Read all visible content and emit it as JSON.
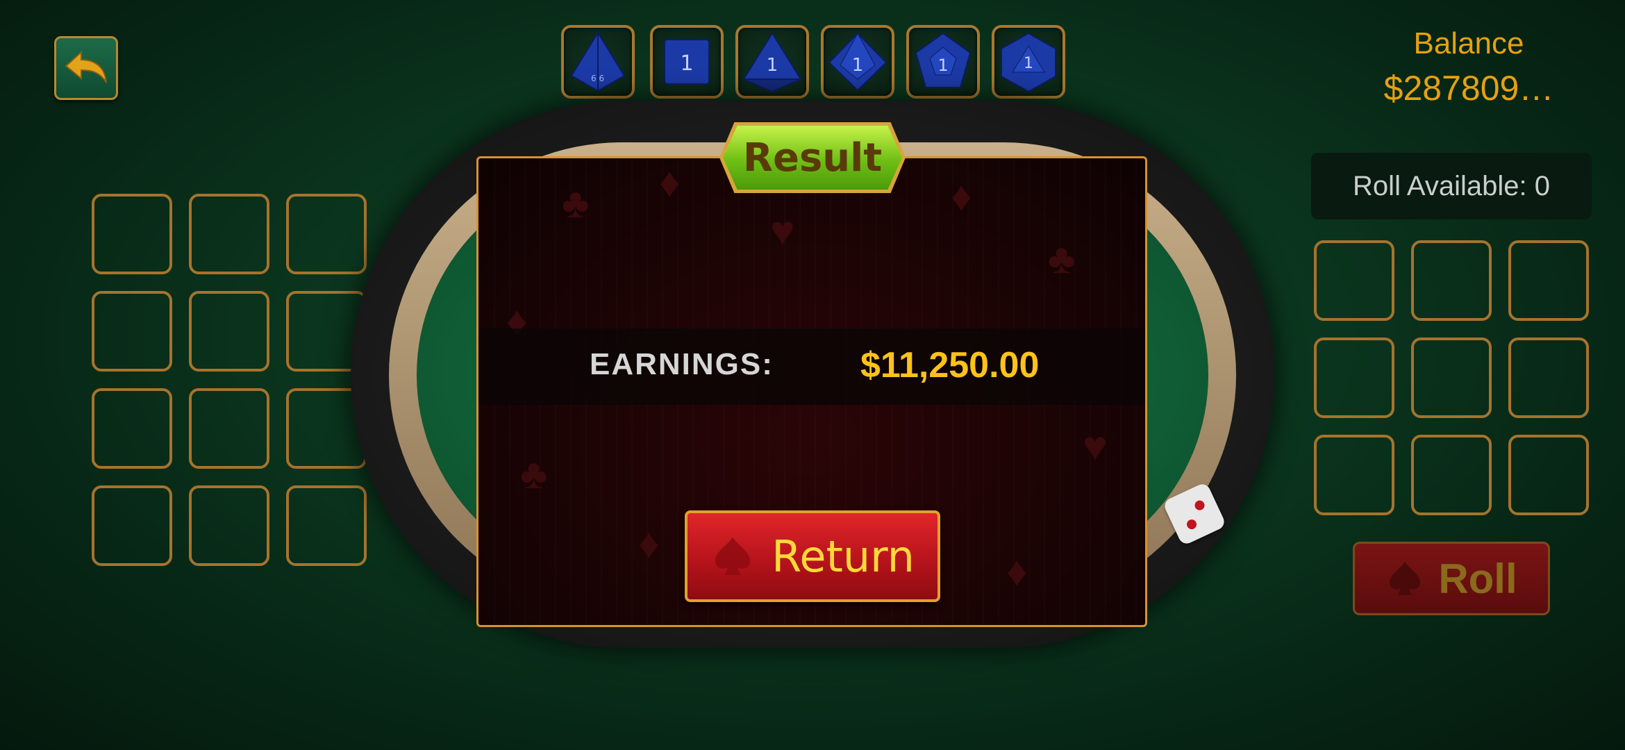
{
  "header": {
    "back_icon": "back-arrow-icon",
    "balance_label": "Balance",
    "balance_value": "$287809…"
  },
  "dice_selector": [
    {
      "name": "d4",
      "face": ""
    },
    {
      "name": "d6",
      "face": "1"
    },
    {
      "name": "d8",
      "face": "1"
    },
    {
      "name": "d10",
      "face": "1"
    },
    {
      "name": "d12",
      "face": "1"
    },
    {
      "name": "d20",
      "face": "1"
    }
  ],
  "right_panel": {
    "roll_available": "Roll Available: 0",
    "roll_label": "Roll"
  },
  "result_modal": {
    "title": "Result",
    "earnings_label": "EARNINGS:",
    "earnings_value": "$11,250.00",
    "return_label": "Return"
  },
  "colors": {
    "gold": "#e6a10f",
    "modal_border": "#d9912f",
    "earnings": "#ffc21a",
    "return_text": "#ffd93b"
  }
}
